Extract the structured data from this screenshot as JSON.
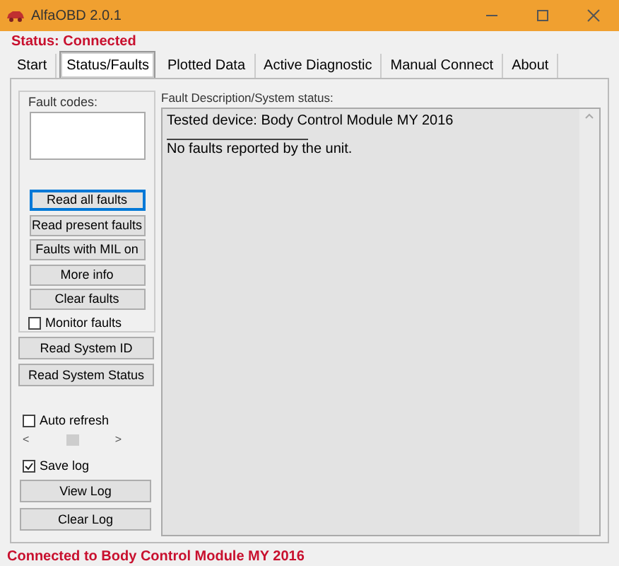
{
  "window": {
    "title": "AlfaOBD 2.0.1"
  },
  "status": "Status: Connected",
  "tabs": [
    {
      "label": "Start",
      "selected": false
    },
    {
      "label": "Status/Faults",
      "selected": true
    },
    {
      "label": "Plotted Data",
      "selected": false
    },
    {
      "label": "Active Diagnostic",
      "selected": false
    },
    {
      "label": "Manual Connect",
      "selected": false
    },
    {
      "label": "About",
      "selected": false
    }
  ],
  "fault_codes": {
    "label": "Fault codes:"
  },
  "fault_buttons": [
    {
      "label": "Read all faults",
      "focused": true
    },
    {
      "label": "Read present faults",
      "focused": false
    },
    {
      "label": "Faults with MIL on",
      "focused": false
    },
    {
      "label": "More info",
      "focused": false
    },
    {
      "label": "Clear faults",
      "focused": false
    }
  ],
  "monitor_faults": {
    "label": "Monitor faults",
    "checked": false
  },
  "system_buttons": [
    "Read System ID",
    "Read System Status"
  ],
  "auto_refresh": {
    "label": "Auto refresh",
    "checked": false,
    "left": "<",
    "right": ">"
  },
  "save_log": {
    "label": "Save log",
    "checked": true
  },
  "log_buttons": [
    "View Log",
    "Clear Log"
  ],
  "description": {
    "label": "Fault Description/System status:",
    "lines": [
      "Tested device: Body Control Module MY 2016",
      "No faults reported by the unit."
    ]
  },
  "status_bar": "Connected to Body Control Module MY 2016"
}
